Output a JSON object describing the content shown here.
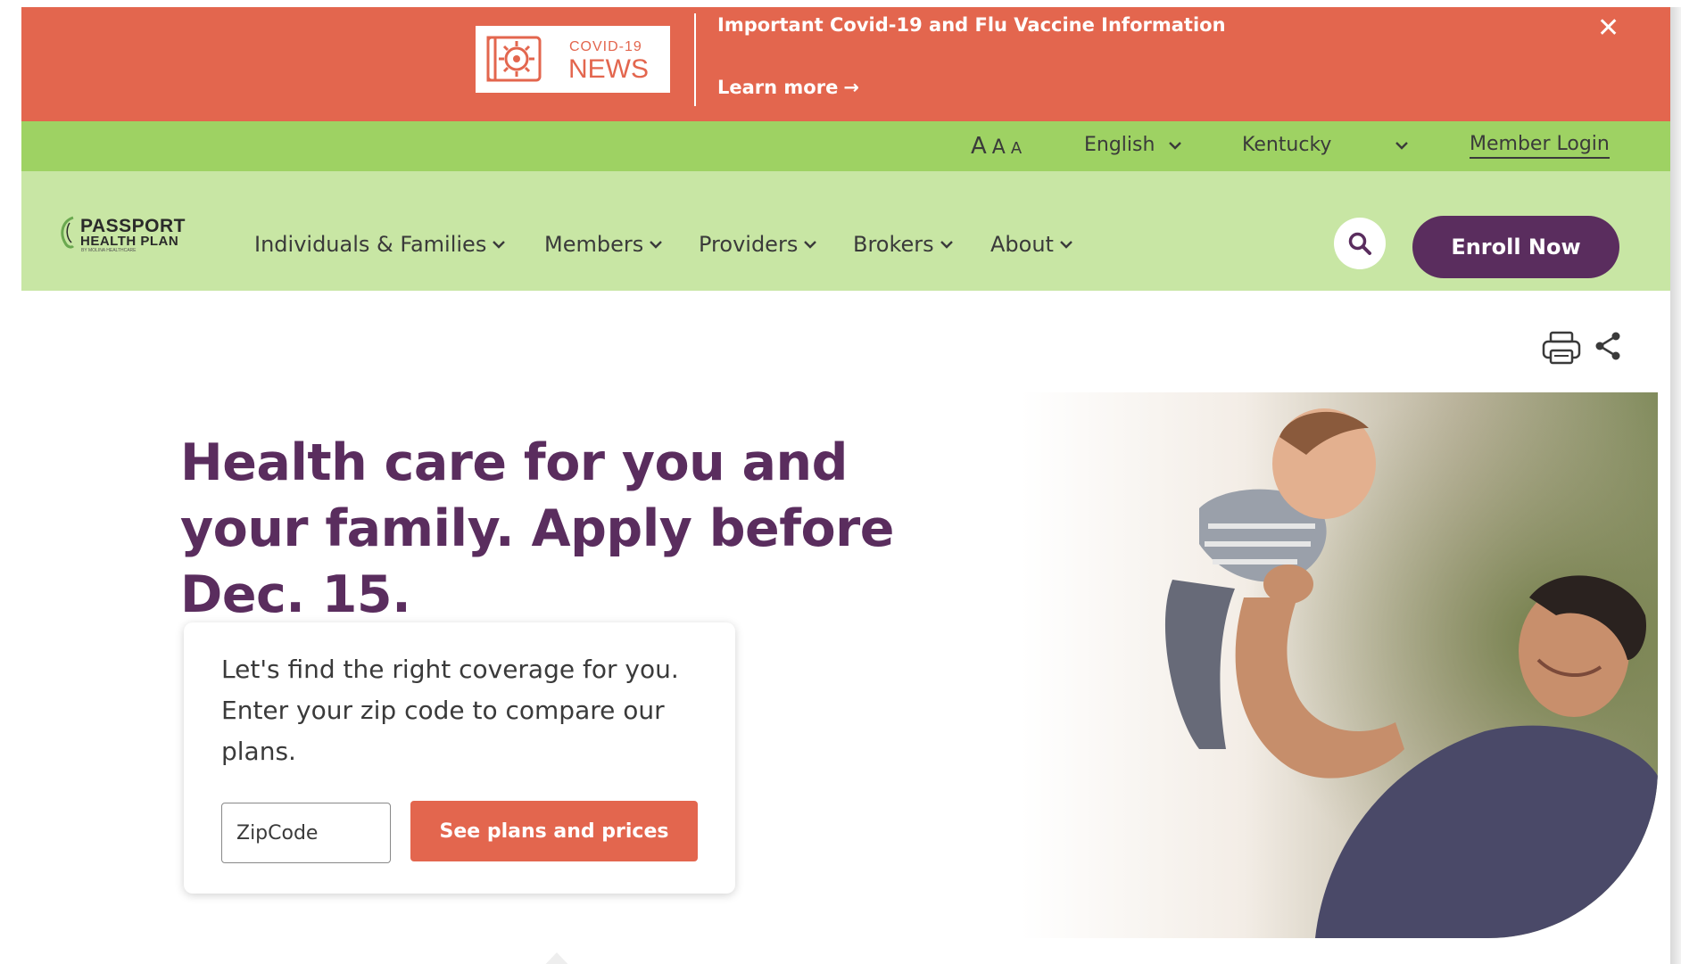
{
  "covid_banner": {
    "badge_small": "COVID-19",
    "badge_big": "NEWS",
    "title": "Important Covid-19 and Flu Vaccine Information",
    "learn_more": "Learn more",
    "background": "#e3664e"
  },
  "utility_bar": {
    "font_size_labels": [
      "A",
      "A",
      "A"
    ],
    "language": "English",
    "state": "Kentucky",
    "member_login": "Member Login",
    "background": "#9ed263"
  },
  "logo": {
    "line1": "PASSPORT",
    "line2": "HEALTH PLAN",
    "line3": "BY MOLINA HEALTHCARE"
  },
  "nav": {
    "items": [
      {
        "label": "Individuals & Families"
      },
      {
        "label": "Members"
      },
      {
        "label": "Providers"
      },
      {
        "label": "Brokers"
      },
      {
        "label": "About"
      }
    ],
    "enroll_label": "Enroll Now",
    "background": "#c8e6a4",
    "accent": "#5a2d5e"
  },
  "hero": {
    "headline": "Health care for you and your family. Apply before Dec. 15.",
    "card_text": "Let's find the right coverage for you. Enter your zip code to compare our plans.",
    "zip_placeholder": "ZipCode",
    "zip_value": "",
    "cta_label": "See plans and prices",
    "cta_color": "#e3664e"
  },
  "icons": [
    "covid-virus-icon",
    "close-icon",
    "chevron-down-icon",
    "search-icon",
    "print-icon",
    "share-icon"
  ]
}
